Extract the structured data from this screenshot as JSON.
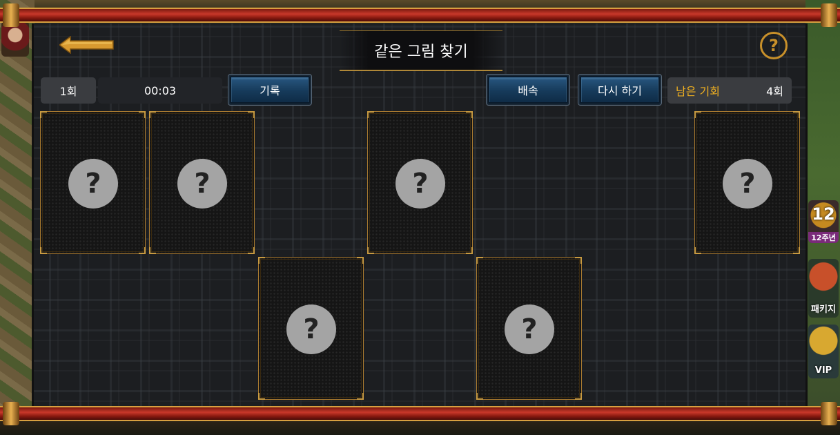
{
  "game": {
    "title": "같은 그림 찾기",
    "help_symbol": "?"
  },
  "toolbar": {
    "round_label": "1회",
    "timer": "00:03",
    "record_label": "기록",
    "double_label": "배속",
    "retry_label": "다시 하기",
    "chances_label": "남은 기회",
    "chances_value": "4회"
  },
  "cards": [
    {
      "state": "face-down",
      "symbol": "?"
    },
    {
      "state": "face-down",
      "symbol": "?"
    },
    {
      "state": "face-down",
      "symbol": "?"
    },
    {
      "state": "face-down",
      "symbol": "?"
    },
    {
      "state": "face-down",
      "symbol": "?"
    },
    {
      "state": "face-down",
      "symbol": "?"
    }
  ],
  "side_menu": {
    "anniversary_number": "12",
    "anniversary_label": "12주년",
    "package_label": "패키지",
    "vip_label": "VIP"
  },
  "colors": {
    "accent_gold": "#c8902a",
    "chance_label": "#f0b020",
    "button_blue": "#163a5a",
    "rail_red": "#c8382a"
  },
  "icons": {
    "back": "arrow-left-icon",
    "help": "question-circle-icon",
    "card": "question-mark-icon"
  }
}
